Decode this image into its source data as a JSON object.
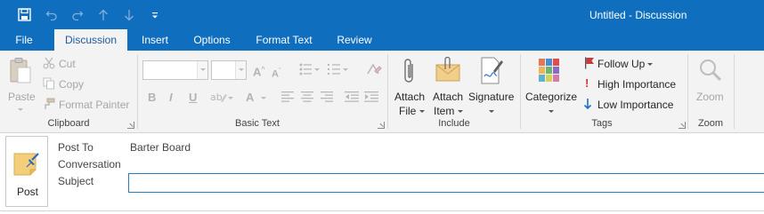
{
  "window": {
    "title": "Untitled  -  Discussion"
  },
  "qat": {
    "icons": [
      "save-icon",
      "undo-icon",
      "redo-icon",
      "up-arrow-icon",
      "down-arrow-icon",
      "customize-icon"
    ]
  },
  "tabs": [
    {
      "label": "File"
    },
    {
      "label": "Discussion"
    },
    {
      "label": "Insert"
    },
    {
      "label": "Options"
    },
    {
      "label": "Format Text"
    },
    {
      "label": "Review"
    }
  ],
  "ribbon": {
    "clipboard": {
      "label": "Clipboard",
      "paste": "Paste",
      "cut": "Cut",
      "copy": "Copy",
      "format_painter": "Format Painter"
    },
    "basic_text": {
      "label": "Basic Text",
      "bold": "B",
      "italic": "I",
      "underline": "U",
      "font_color": "A"
    },
    "include": {
      "label": "Include",
      "attach_file": [
        "Attach",
        "File"
      ],
      "attach_item": [
        "Attach",
        "Item"
      ],
      "signature": "Signature"
    },
    "tags": {
      "label": "Tags",
      "categorize": "Categorize",
      "follow_up": "Follow Up",
      "high_importance": "High Importance",
      "low_importance": "Low Importance"
    },
    "zoom": {
      "label": "Zoom",
      "zoom": "Zoom"
    }
  },
  "compose": {
    "post_button": "Post",
    "post_to_label": "Post To",
    "post_to_value": "Barter Board",
    "conversation_label": "Conversation",
    "subject_label": "Subject",
    "subject_value": ""
  },
  "colors": {
    "titlebar": "#106ebe",
    "ribbon_bg": "#f3f3f3",
    "high_importance": "#d13438",
    "low_importance": "#1f6fc5",
    "follow_up_flag": "#c43e3e"
  }
}
